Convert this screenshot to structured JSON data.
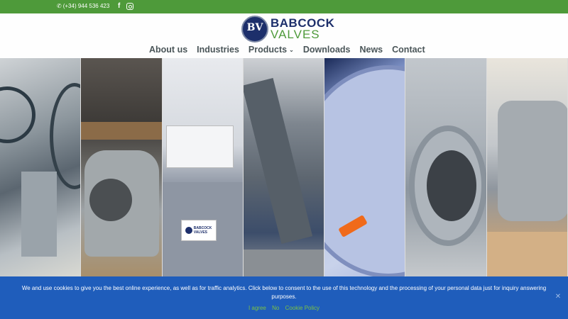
{
  "topbar": {
    "phone": "(+34) 944 536 423",
    "phone_icon": "phone-icon",
    "social": [
      "facebook-icon",
      "instagram-icon"
    ],
    "bg_color": "#4e9a3a"
  },
  "brand": {
    "line1": "BABCOCK",
    "line2": "VALVES",
    "mark": "BV",
    "primary_color": "#1d2f6b",
    "accent_color": "#4e9a3a"
  },
  "nav": {
    "items": [
      {
        "label": "About us"
      },
      {
        "label": "Industries"
      },
      {
        "label": "Products"
      },
      {
        "label": "Downloads"
      },
      {
        "label": "News"
      },
      {
        "label": "Contact"
      }
    ]
  },
  "hero": {
    "sign_line1": "BABCOCK",
    "sign_line2": "VALVES",
    "panel_count": 7
  },
  "cookie": {
    "text": "We and use cookies to give you the best online experience, as well as for traffic analytics. Click below to consent to the use of this technology and the processing of your personal data just for inquiry answering purposes.",
    "agree": "I agree",
    "no": "No",
    "policy": "Cookie Policy",
    "close_icon": "close-icon",
    "bg_color": "#1f5dbb",
    "link_color": "#7cc242"
  }
}
